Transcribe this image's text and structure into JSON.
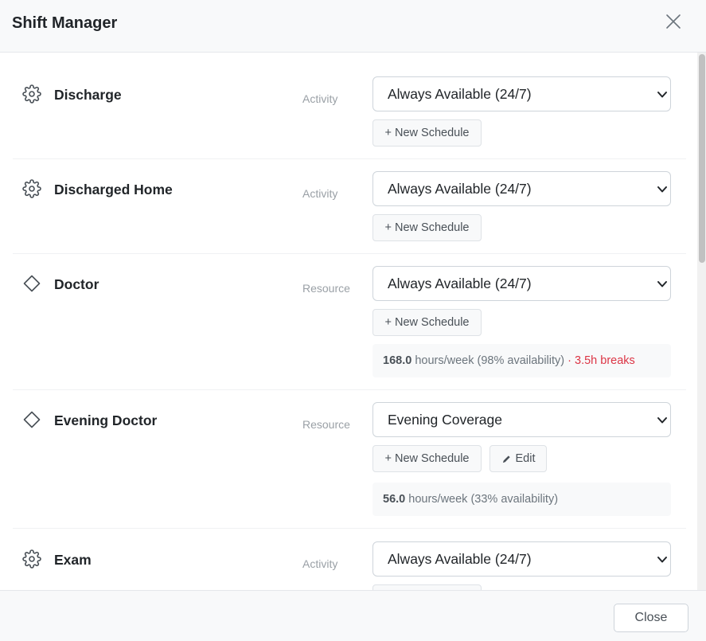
{
  "header": {
    "title": "Shift Manager"
  },
  "rows": [
    {
      "name": "Discharge",
      "type": "Activity",
      "icon": "gear-icon",
      "schedule": "Always Available (24/7)",
      "new_schedule_label": "+ New Schedule"
    },
    {
      "name": "Discharged Home",
      "type": "Activity",
      "icon": "gear-icon",
      "schedule": "Always Available (24/7)",
      "new_schedule_label": "+ New Schedule"
    },
    {
      "name": "Doctor",
      "type": "Resource",
      "icon": "diamond-icon",
      "schedule": "Always Available (24/7)",
      "new_schedule_label": "+ New Schedule",
      "summary": {
        "hours": "168.0",
        "text": " hours/week (98% availability)",
        "separator": " · ",
        "breaks": "3.5h breaks"
      }
    },
    {
      "name": "Evening Doctor",
      "type": "Resource",
      "icon": "diamond-icon",
      "schedule": "Evening Coverage",
      "new_schedule_label": "+ New Schedule",
      "edit_label": "Edit",
      "summary": {
        "hours": "56.0",
        "text": " hours/week (33% availability)"
      }
    },
    {
      "name": "Exam",
      "type": "Activity",
      "icon": "gear-icon",
      "schedule": "Always Available (24/7)"
    }
  ],
  "footer": {
    "close_label": "Close"
  },
  "colors": {
    "breaks": "#dc3545",
    "header_bg": "#f8f9fa"
  }
}
